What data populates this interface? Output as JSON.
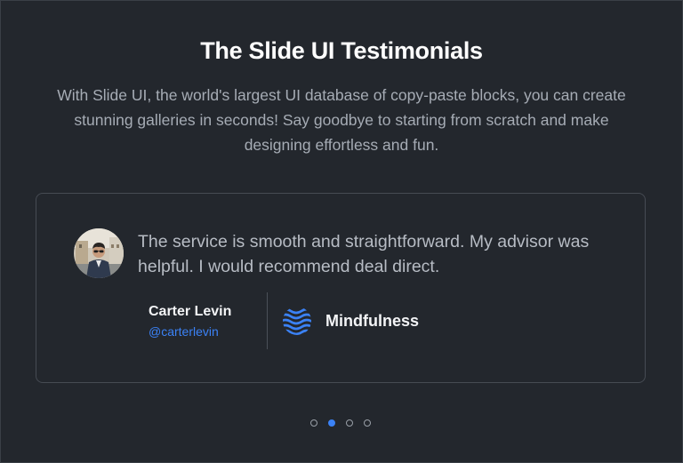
{
  "header": {
    "title": "The Slide UI Testimonials",
    "subtitle": "With Slide UI, the world's largest UI database of copy-paste blocks, you can create stunning galleries in seconds! Say goodbye to starting from scratch and make designing effortless and fun."
  },
  "testimonial": {
    "quote": "The service is smooth and straightforward. My advisor was helpful. I would recommend deal direct.",
    "author_name": "Carter Levin",
    "author_handle": "@carterlevin",
    "company_name": "Mindfulness",
    "company_logo_icon": "waves-icon"
  },
  "pagination": {
    "count": 4,
    "active_index": 1
  },
  "colors": {
    "background": "#23272d",
    "accent": "#3b82f6"
  }
}
